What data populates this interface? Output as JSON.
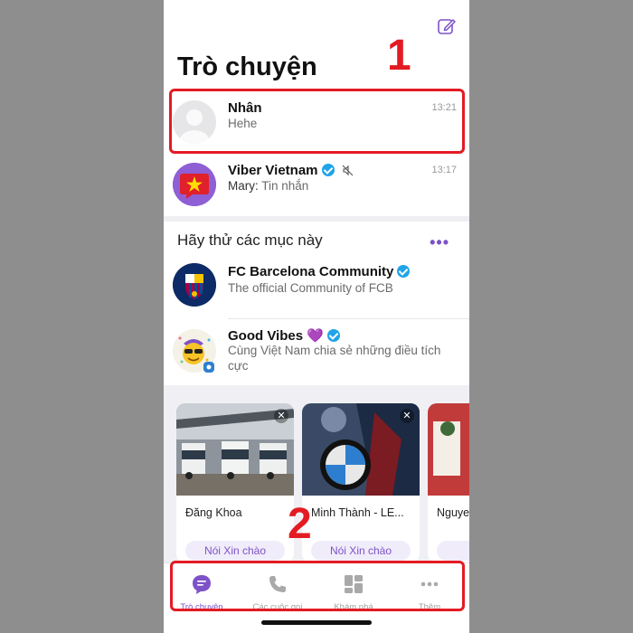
{
  "header": {
    "title": "Trò chuyện",
    "compose_icon": "compose-icon"
  },
  "chats": [
    {
      "name": "Nhân",
      "message": "Hehe",
      "time": "13:21"
    },
    {
      "name": "Viber Vietnam",
      "sender": "Mary:",
      "message": "Tin nhắn",
      "time": "13:17"
    }
  ],
  "suggestions": {
    "title": "Hãy thử các mục này",
    "items": [
      {
        "name": "FC Barcelona Community",
        "description": "The official Community of FCB"
      },
      {
        "name": "Good Vibes 💜",
        "description_line1": "Cùng Việt Nam chia sẻ những điều tích",
        "description_line2": "cực"
      }
    ]
  },
  "people_cards": [
    {
      "name": "Đăng Khoa",
      "button": "Nói Xin chào"
    },
    {
      "name": "Minh Thành - LE...",
      "button": "Nói Xin chào"
    },
    {
      "name": "Nguye",
      "button": "Nó"
    }
  ],
  "tabbar": {
    "tabs": [
      {
        "label": "Trò chuyện",
        "icon": "chat-bubble-icon",
        "active": true
      },
      {
        "label": "Các cuộc gọi",
        "icon": "phone-icon",
        "active": false
      },
      {
        "label": "Khám phá",
        "icon": "explore-grid-icon",
        "active": false
      },
      {
        "label": "Thêm",
        "icon": "more-dots-icon",
        "active": false
      }
    ]
  },
  "annotations": {
    "marker1": "1",
    "marker2": "2"
  },
  "colors": {
    "accent": "#7d52c7",
    "annotation": "#e31b23",
    "verified": "#1fa4e8"
  }
}
